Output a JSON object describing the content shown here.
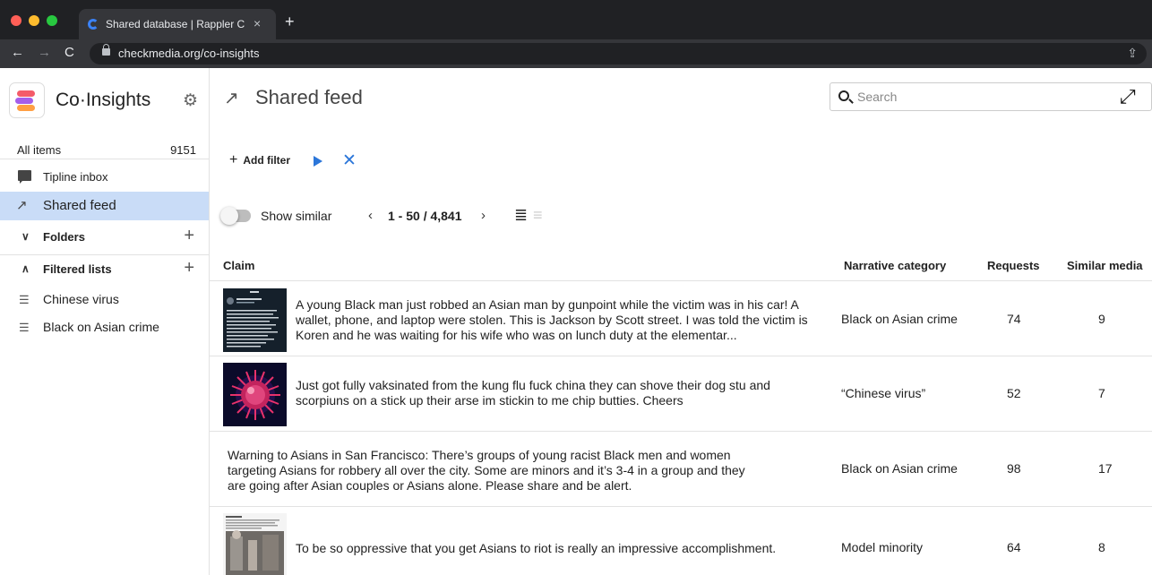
{
  "browser": {
    "tab_title": "Shared database | Rappler Che",
    "tab_close": "×",
    "new_tab": "+",
    "url": "checkmedia.org/co-insights"
  },
  "sidebar": {
    "brand": "Co·Insights",
    "all_items_label": "All items",
    "all_items_count": "9151",
    "tipline_label": "Tipline inbox",
    "shared_feed_label": "Shared feed",
    "folders_label": "Folders",
    "filtered_lists_label": "Filtered lists",
    "lists": [
      {
        "label": "Chinese virus"
      },
      {
        "label": "Black on Asian crime"
      }
    ]
  },
  "main": {
    "title": "Shared feed",
    "search_placeholder": "Search",
    "add_filter_label": "Add filter",
    "show_similar_label": "Show similar",
    "pagination": "1 - 50 / 4,841"
  },
  "table": {
    "headers": {
      "claim": "Claim",
      "category": "Narrative category",
      "requests": "Requests",
      "similar": "Similar media"
    },
    "rows": [
      {
        "claim": "A young Black man just robbed an Asian man by gunpoint while the victim was in his car! A wallet, phone, and laptop were stolen. This is Jackson by Scott street. I was told the victim is Koren and he was waiting for his wife who was on lunch duty at the elementar...",
        "category": "Black on Asian crime",
        "requests": "74",
        "similar": "9"
      },
      {
        "claim": "Just got fully vaksinated from the kung flu fuck china they can shove their dog stu and scorpiuns on a stick up their arse im stickin to me chip butties. Cheers",
        "category": "“Chinese virus”",
        "requests": "52",
        "similar": "7"
      },
      {
        "claim": "Warning to Asians in San Francisco: There’s groups of young racist Black men and women targeting Asians for robbery all over the city. Some are minors and it’s 3-4 in a group and they are going after Asian couples or Asians alone. Please share and be alert.",
        "category": "Black on Asian crime",
        "requests": "98",
        "similar": "17"
      },
      {
        "claim": "To be so oppressive that you get Asians to riot is really an impressive accomplishment.",
        "category": "Model minority",
        "requests": "64",
        "similar": "8"
      }
    ]
  },
  "icons": {
    "gear": "gear-icon",
    "search": "search-icon",
    "expand": "expand-icon",
    "play": "play-icon",
    "clear": "close-icon"
  },
  "colors": {
    "accent": "#2b76d9",
    "selected_row": "#c9dcf7"
  }
}
